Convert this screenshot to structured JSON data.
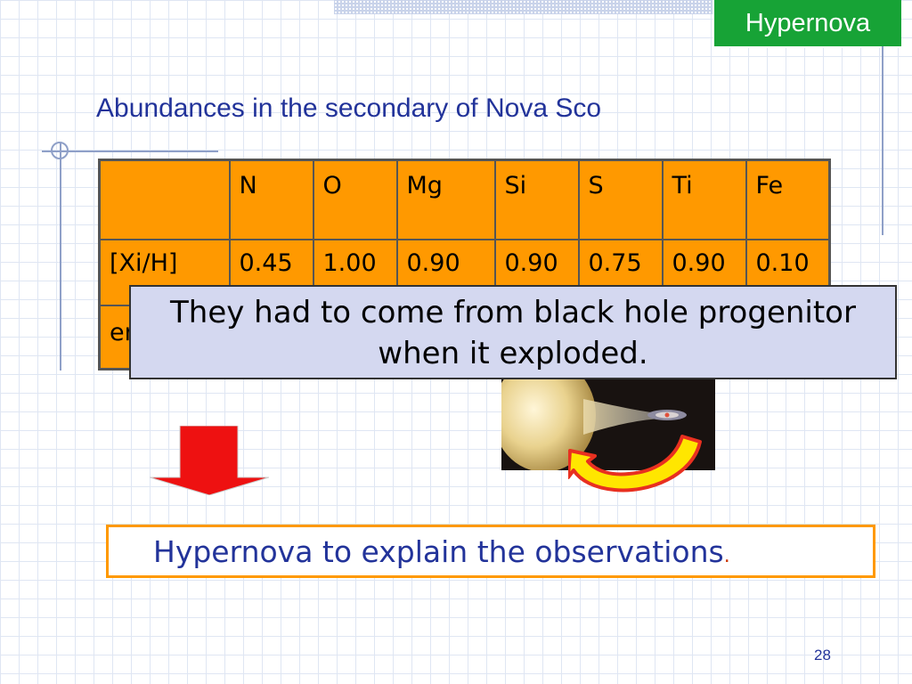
{
  "slide": {
    "tag": "Hypernova",
    "subtitle": "Abundances in the secondary of Nova Sco",
    "page_number": "28"
  },
  "table": {
    "header": [
      "",
      "N",
      "O",
      "Mg",
      "Si",
      "S",
      "Ti",
      "Fe"
    ],
    "rows": [
      [
        "[Xi/H]",
        "0.45",
        "1.00",
        "0.90",
        "0.90",
        "0.75",
        "0.90",
        "0.10"
      ],
      [
        "er",
        "",
        "",
        "",
        "",
        "",
        "",
        ""
      ]
    ]
  },
  "callout": {
    "line1": "They had to come from black hole progenitor",
    "line2": "when it exploded."
  },
  "conclusion": {
    "text": "Hypernova to explain the observations",
    "period": "."
  },
  "colors": {
    "tag_bg": "#17a336",
    "table_bg": "#ff9900",
    "callout_bg": "#d4d8f0",
    "text_blue": "#22339a",
    "arrow_red": "#ee1111",
    "arrow_yellow": "#ffe600"
  },
  "icons": {
    "down_arrow": "red-down-arrow-icon",
    "curved_arrow": "yellow-curved-arrow-icon"
  }
}
